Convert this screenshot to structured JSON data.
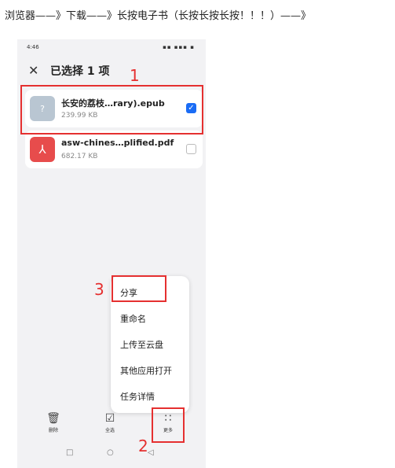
{
  "caption": "浏览器——》下载——》长按电子书（长按长按长按！！！）——》",
  "status": {
    "time": "4:46",
    "icons": "▪▪ ▪▪▪ ▪"
  },
  "header": {
    "close_icon": "close-icon",
    "title": "已选择 1 项"
  },
  "files": [
    {
      "name": "长安的荔枝…rary).epub",
      "size": "239.99 KB",
      "type": "epub",
      "icon": "?",
      "selected": true
    },
    {
      "name": "asw-chines…plified.pdf",
      "size": "682.17 KB",
      "type": "pdf",
      "icon": "⅄",
      "selected": false
    }
  ],
  "menu": {
    "items": [
      "分享",
      "重命名",
      "上传至云盘",
      "其他应用打开",
      "任务详情"
    ]
  },
  "bottom_bar": {
    "delete": {
      "icon": "🗑",
      "label": "删除"
    },
    "select_all": {
      "icon": "☑",
      "label": "全选"
    },
    "more": {
      "icon": "∷",
      "label": "更多"
    }
  },
  "nav": {
    "recent": "□",
    "home": "○",
    "back": "◁"
  },
  "annotations": [
    "1",
    "2",
    "3"
  ],
  "annotation_color": "#e53030",
  "accent_color": "#1a6cf5"
}
